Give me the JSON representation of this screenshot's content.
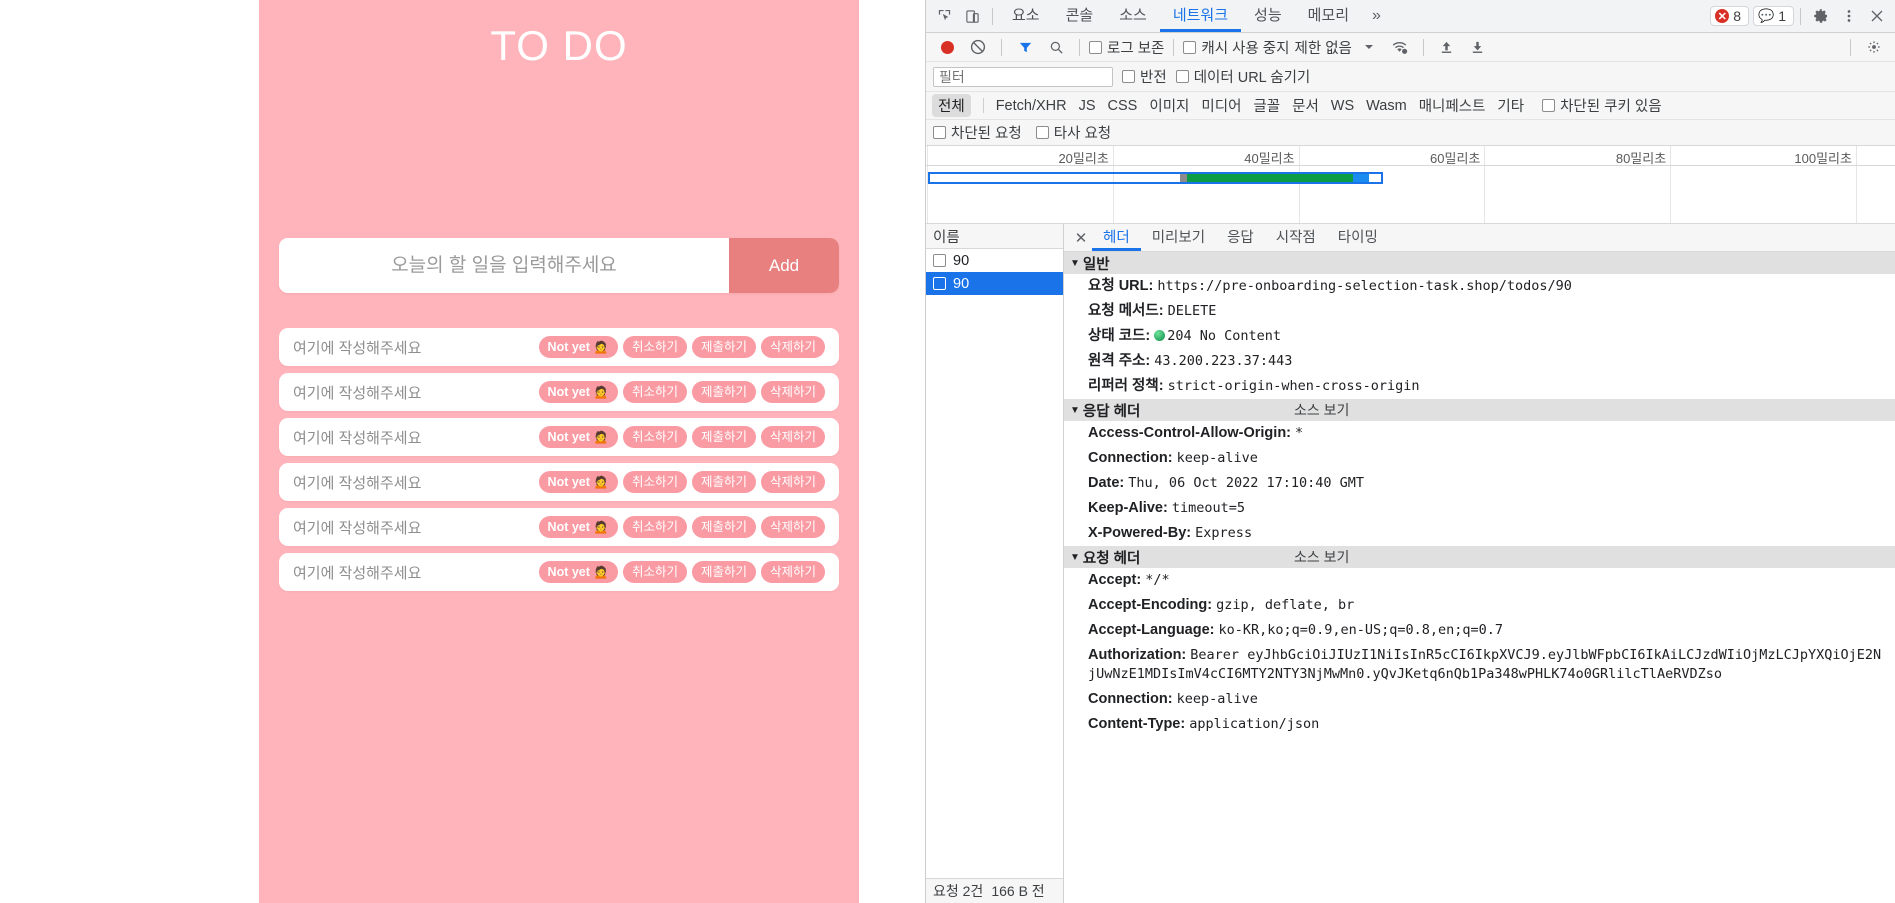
{
  "todo_app": {
    "title": "TO DO",
    "input": {
      "placeholder": "오늘의 할 일을 입력해주세요",
      "value": ""
    },
    "add_label": "Add",
    "chips": {
      "status": "Not yet 🙍",
      "cancel": "취소하기",
      "submit": "제출하기",
      "delete": "삭제하기"
    },
    "items": [
      {
        "text": "여기에 작성해주세요"
      },
      {
        "text": "여기에 작성해주세요"
      },
      {
        "text": "여기에 작성해주세요"
      },
      {
        "text": "여기에 작성해주세요"
      },
      {
        "text": "여기에 작성해주세요"
      },
      {
        "text": "여기에 작성해주세요"
      }
    ],
    "colors": {
      "background": "#ffb3ba",
      "chip": "#fa9aa2",
      "add_button": "#e98080"
    }
  },
  "devtools": {
    "tabs": [
      {
        "label": "요소",
        "active": false
      },
      {
        "label": "콘솔",
        "active": false
      },
      {
        "label": "소스",
        "active": false
      },
      {
        "label": "네트워크",
        "active": true
      },
      {
        "label": "성능",
        "active": false
      },
      {
        "label": "메모리",
        "active": false
      }
    ],
    "more_tabs_icon": "»",
    "error_count": "8",
    "message_count": "1",
    "settings_icon": "gear-icon",
    "kebab_icon": "more-vertical-icon",
    "close_icon": "close-icon",
    "net_toolbar": {
      "record_label": "record-button",
      "clear_label": "clear-button",
      "filter_icon": "filter-icon",
      "search_icon": "search-icon",
      "preserve_log": "로그 보존",
      "disable_cache": "캐시 사용 중지",
      "throttling": "제한 없음",
      "wifi_icon": "network-conditions-icon",
      "import_icon": "import-har-icon",
      "export_icon": "export-har-icon"
    },
    "filter_row": {
      "placeholder": "필터",
      "value": "",
      "invert": "반전",
      "hide_data_urls": "데이터 URL 숨기기"
    },
    "type_filters": [
      {
        "label": "전체",
        "active": true
      },
      {
        "label": "Fetch/XHR",
        "active": false
      },
      {
        "label": "JS",
        "active": false
      },
      {
        "label": "CSS",
        "active": false
      },
      {
        "label": "이미지",
        "active": false
      },
      {
        "label": "미디어",
        "active": false
      },
      {
        "label": "글꼴",
        "active": false
      },
      {
        "label": "문서",
        "active": false
      },
      {
        "label": "WS",
        "active": false
      },
      {
        "label": "Wasm",
        "active": false
      },
      {
        "label": "매니페스트",
        "active": false
      },
      {
        "label": "기타",
        "active": false
      }
    ],
    "has_blocked_cookies": "차단된 쿠키 있음",
    "blocked_requests": "차단된 요청",
    "third_party_requests": "타사 요청",
    "overview": {
      "ticks": [
        "20밀리초",
        "40밀리초",
        "60밀리초",
        "80밀리초",
        "100밀리초"
      ]
    },
    "request_list": {
      "column_header": "이름",
      "rows": [
        {
          "name": "90",
          "selected": false
        },
        {
          "name": "90",
          "selected": true
        }
      ],
      "footer": {
        "requests": "요청 2건",
        "transferred": "166 B 전"
      }
    },
    "detail_tabs": [
      {
        "label": "헤더",
        "active": true
      },
      {
        "label": "미리보기",
        "active": false
      },
      {
        "label": "응답",
        "active": false
      },
      {
        "label": "시작점",
        "active": false
      },
      {
        "label": "타이밍",
        "active": false
      }
    ],
    "sections": [
      {
        "title": "일반",
        "source_view": null,
        "rows": [
          {
            "key": "요청 URL:",
            "value": "https://pre-onboarding-selection-task.shop/todos/90",
            "status_dot": false
          },
          {
            "key": "요청 메서드:",
            "value": "DELETE",
            "status_dot": false
          },
          {
            "key": "상태 코드:",
            "value": "204 No Content",
            "status_dot": true
          },
          {
            "key": "원격 주소:",
            "value": "43.200.223.37:443",
            "status_dot": false
          },
          {
            "key": "리퍼러 정책:",
            "value": "strict-origin-when-cross-origin",
            "status_dot": false
          }
        ]
      },
      {
        "title": "응답 헤더",
        "source_view": "소스 보기",
        "rows": [
          {
            "key": "Access-Control-Allow-Origin:",
            "value": "*",
            "status_dot": false
          },
          {
            "key": "Connection:",
            "value": "keep-alive",
            "status_dot": false
          },
          {
            "key": "Date:",
            "value": "Thu, 06 Oct 2022 17:10:40 GMT",
            "status_dot": false
          },
          {
            "key": "Keep-Alive:",
            "value": "timeout=5",
            "status_dot": false
          },
          {
            "key": "X-Powered-By:",
            "value": "Express",
            "status_dot": false
          }
        ]
      },
      {
        "title": "요청 헤더",
        "source_view": "소스 보기",
        "rows": [
          {
            "key": "Accept:",
            "value": "*/*",
            "status_dot": false
          },
          {
            "key": "Accept-Encoding:",
            "value": "gzip, deflate, br",
            "status_dot": false
          },
          {
            "key": "Accept-Language:",
            "value": "ko-KR,ko;q=0.9,en-US;q=0.8,en;q=0.7",
            "status_dot": false
          },
          {
            "key": "Authorization:",
            "value": "Bearer eyJhbGciOiJIUzI1NiIsInR5cCI6IkpXVCJ9.eyJlbWFpbCI6IkAiLCJzdWIiOjMzLCJpYXQiOjE2NjUwNzE1MDIsImV4cCI6MTY2NTY3NjMwMn0.yQvJKetq6nQb1Pa348wPHLK74o0GRlilcTlAeRVDZso",
            "status_dot": false
          },
          {
            "key": "Connection:",
            "value": "keep-alive",
            "status_dot": false
          },
          {
            "key": "Content-Type:",
            "value": "application/json",
            "status_dot": false
          }
        ]
      }
    ]
  }
}
